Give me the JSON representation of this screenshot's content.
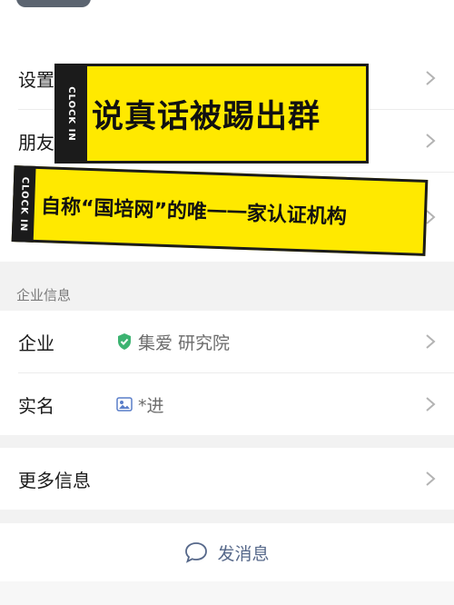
{
  "rows": {
    "settings_label": "设置",
    "friends_label": "朋友"
  },
  "banner_top": {
    "tab_text": "CLOCK IN",
    "headline": "说真话被踢出群"
  },
  "banner_bottom": {
    "tab_text": "CLOCK IN",
    "headline": "自称“国培网”的唯一一家认证机构"
  },
  "enterprise_section": {
    "title": "企业信息",
    "enterprise_label": "企业",
    "enterprise_value": "集爱 研究院",
    "enterprise_icon": "verified-shield-icon",
    "realname_label": "实名",
    "realname_value": "*进",
    "realname_icon": "id-card-icon"
  },
  "more_info": {
    "label": "更多信息"
  },
  "send_message": {
    "label": "发消息",
    "icon": "chat-bubble-icon"
  },
  "colors": {
    "banner_yellow": "#ffe900",
    "verified_green": "#3cb371",
    "link_blue": "#56688a"
  }
}
